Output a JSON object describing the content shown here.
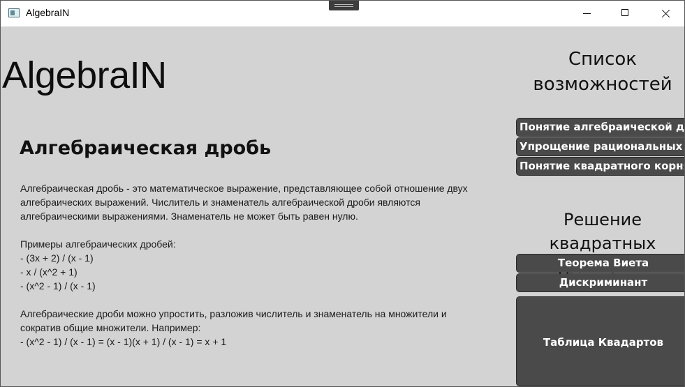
{
  "window": {
    "title": "AlgebraIN"
  },
  "app": {
    "logo": "AlgebraIN"
  },
  "article": {
    "title": "Алгебраическая дробь",
    "body": "Алгебраическая дробь - это математическое выражение, представляющее собой отношение двух\nалгебраических выражений. Числитель и знаменатель алгебраической дроби являются\nалгебраическими выражениями. Знаменатель не может быть равен нулю.\n\nПримеры алгебраических дробей:\n- (3x + 2) / (x - 1)\n- x / (x^2 + 1)\n- (x^2 - 1) / (x - 1)\n\nАлгебраические дроби можно упростить, разложив числитель и знаменатель на множители и\nсократив общие множители. Например:\n- (x^2 - 1) / (x - 1) = (x - 1)(x + 1) / (x - 1) = x + 1"
  },
  "sidebar": {
    "features_heading": "Список возможностей",
    "features": [
      "Понятие алгебраической дро",
      "Упрощение рациональных в",
      "Понятие квадратного корня"
    ],
    "quadratic_heading": "Решение квадратных уравнений",
    "quadratic": [
      "Теорема Виета",
      "Дискриминант"
    ],
    "table_button": "Таблица Квадартов"
  }
}
